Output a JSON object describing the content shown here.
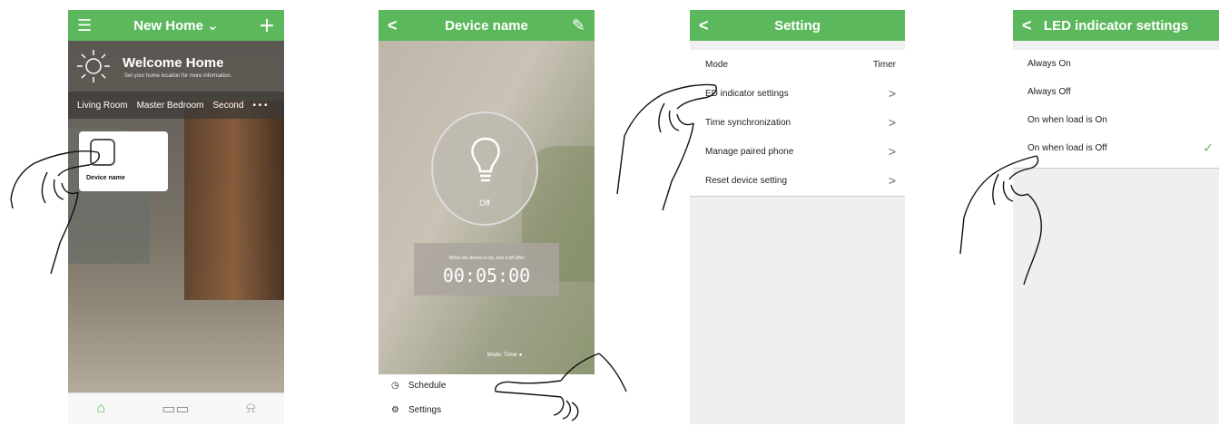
{
  "colors": {
    "accent": "#5cb85c",
    "check": "#5cb85c"
  },
  "screen1": {
    "header": {
      "title": "New Home",
      "caret": "⌄",
      "menu_icon": "hamburger-icon",
      "add_icon": "plus-icon"
    },
    "welcome": {
      "title": "Welcome Home",
      "subtitle": "Set your home location for more information."
    },
    "rooms": [
      "Living Room",
      "Master Bedroom",
      "Second",
      "• • •"
    ],
    "device_card": {
      "name": "Device name"
    },
    "tabs": [
      "home-icon",
      "grid-icon",
      "alarm-icon"
    ]
  },
  "screen2": {
    "header": {
      "title": "Device name",
      "back": "<",
      "edit_icon": "pencil-icon"
    },
    "state": "Off",
    "timer": {
      "caption": "When the device is on, turn it off after",
      "value": "00:05:00"
    },
    "mode_label": "Mode: Timer",
    "menu": [
      {
        "icon": "clock-icon",
        "glyph": "◷",
        "label": "Schedule"
      },
      {
        "icon": "gear-icon",
        "glyph": "⚙",
        "label": "Settings"
      }
    ]
  },
  "screen3": {
    "header": {
      "title": "Setting",
      "back": "<"
    },
    "rows": [
      {
        "label": "Mode",
        "value": "Timer"
      },
      {
        "label": "ED indicator settings",
        "chevron": ">"
      },
      {
        "label": "Time synchronization",
        "chevron": ">"
      },
      {
        "label": "Manage paired phone",
        "chevron": ">"
      },
      {
        "label": "Reset device setting",
        "chevron": ">"
      }
    ]
  },
  "screen4": {
    "header": {
      "title": "LED indicator settings",
      "back": "<"
    },
    "options": [
      "Always On",
      "Always Off",
      "On when load is On",
      "On when load is Off"
    ],
    "check": "✓",
    "selected_index": 3
  }
}
